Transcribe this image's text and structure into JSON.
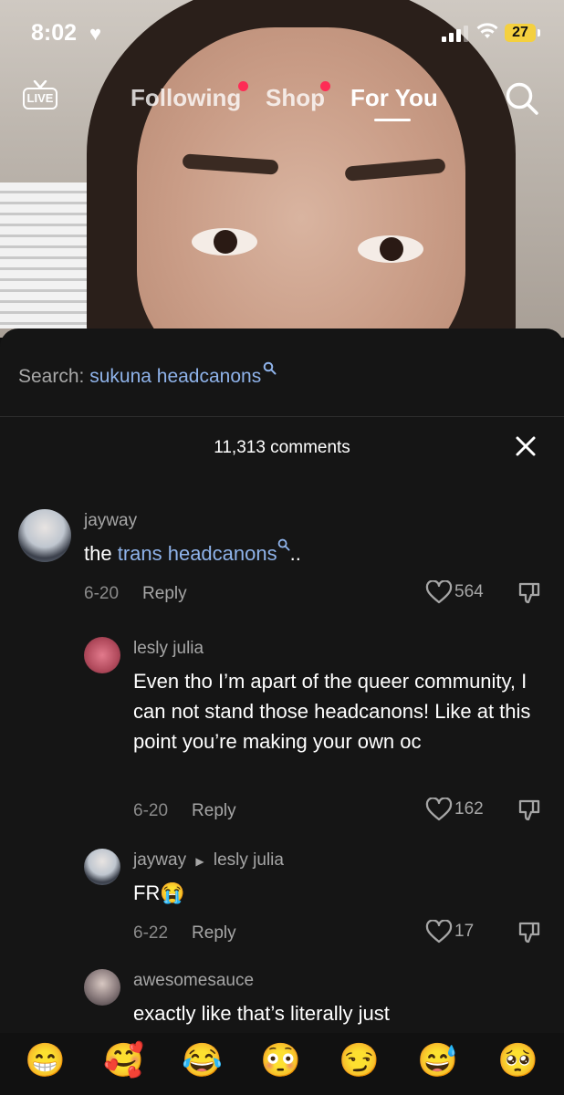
{
  "status": {
    "time": "8:02",
    "battery": "27"
  },
  "nav": {
    "live": "LIVE",
    "tabs": [
      "Following",
      "Shop",
      "For You"
    ],
    "active": "For You"
  },
  "search_suggestion": {
    "prefix": "Search: ",
    "term": "sukuna headcanons"
  },
  "comments_header": {
    "count": "11,313 comments"
  },
  "comments": [
    {
      "user": "jayway",
      "text_before": "the ",
      "link": "trans headcanons",
      "text_after": "..",
      "date": "6-20",
      "reply": "Reply",
      "likes": "564"
    },
    {
      "user": "lesly julia",
      "text": "Even tho I’m apart of the queer community, I can not stand those headcanons! Like at this point you’re making your own oc",
      "date": "6-20",
      "reply": "Reply",
      "likes": "162"
    },
    {
      "user": "jayway",
      "reply_to": "lesly julia",
      "text": "FR",
      "emoji": "😭",
      "date": "6-22",
      "reply": "Reply",
      "likes": "17"
    },
    {
      "user": "awesomesauce",
      "text": "exactly like that’s literally just"
    }
  ],
  "emoji_bar": [
    "😁",
    "🥰",
    "😂",
    "😳",
    "😏",
    "😅",
    "🥺"
  ],
  "colors": {
    "link": "#8fb3ea",
    "notification_dot": "#fe2c55",
    "sheet_bg": "#151515"
  }
}
